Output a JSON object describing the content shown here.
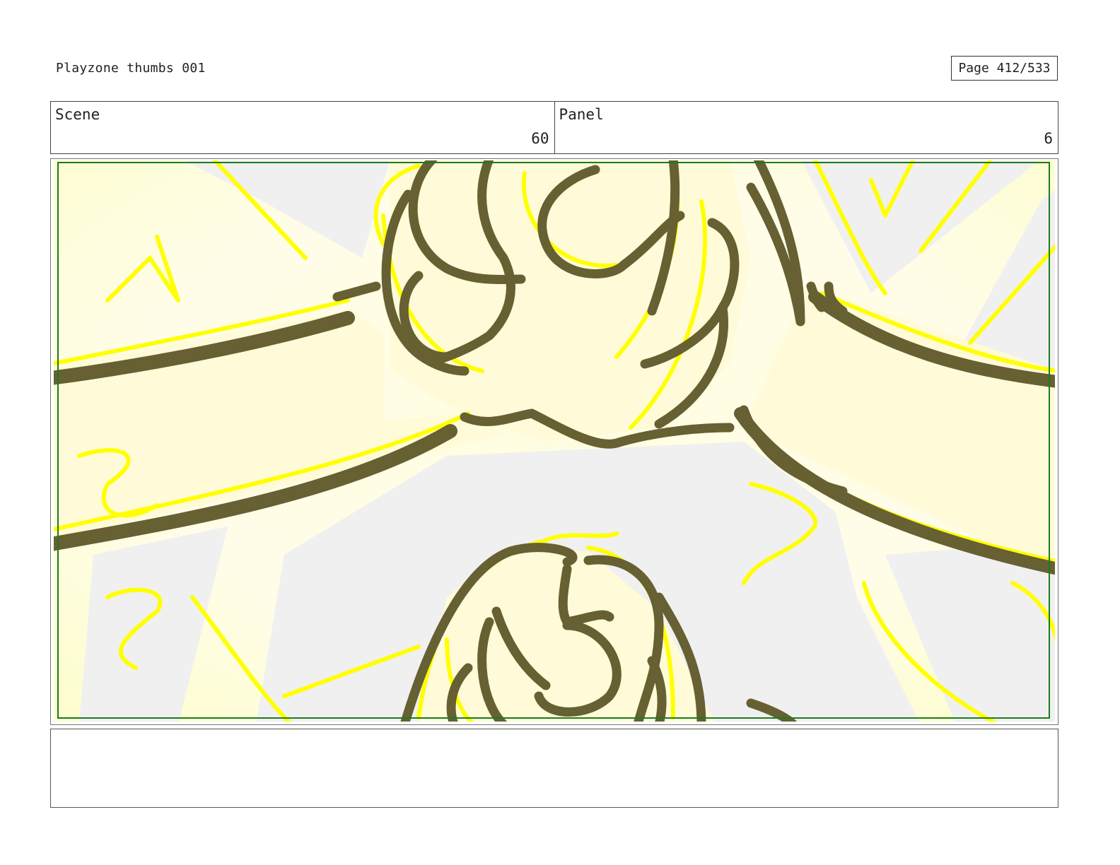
{
  "header": {
    "title": "Playzone thumbs 001",
    "page_label": "Page 412/533"
  },
  "info": {
    "scene_label": "Scene",
    "scene_value": "60",
    "panel_label": "Panel",
    "panel_value": "6"
  },
  "panel": {
    "artwork": "storyboard-sketch",
    "colors": {
      "line": "#666032",
      "highlight": "#ffff00",
      "fill": "#fffde0",
      "background": "#f0f0f0",
      "safe_frame": "#1e7a1e"
    }
  },
  "notes": {
    "text": ""
  }
}
